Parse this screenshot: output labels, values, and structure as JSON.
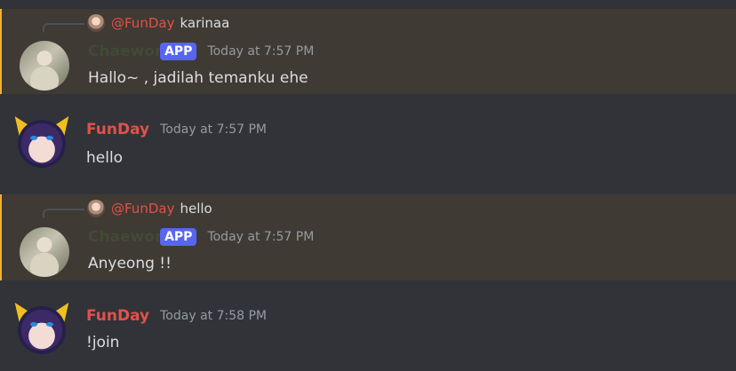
{
  "messages": [
    {
      "reply": {
        "author": "@FunDay",
        "text": "karinaa"
      },
      "author": "Chaewon",
      "badge": "APP",
      "timestamp": "Today at 7:57 PM",
      "content": "Hallo~ , jadilah temanku ehe"
    },
    {
      "author": "FunDay",
      "timestamp": "Today at 7:57 PM",
      "content": "hello"
    },
    {
      "reply": {
        "author": "@FunDay",
        "text": "hello"
      },
      "author": "Chaewon",
      "badge": "APP",
      "timestamp": "Today at 7:57 PM",
      "content": "Anyeong !!"
    },
    {
      "author": "FunDay",
      "timestamp": "Today at 7:58 PM",
      "content": "!join"
    }
  ],
  "colors": {
    "background": "#313338",
    "mention_highlight": "#3f3a33",
    "mention_bar": "#f0b232",
    "author_red": "#e0524a",
    "badge": "#5865f2",
    "timestamp": "#949ba4",
    "text": "#dbdee1"
  }
}
